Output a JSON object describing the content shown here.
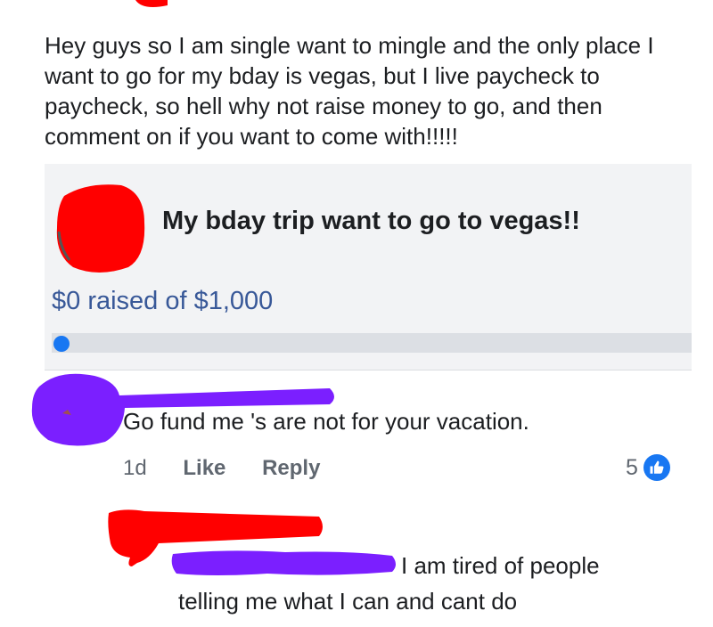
{
  "post": {
    "text": "Hey guys so I am single want to mingle and the only place I want to go for my bday is vegas, but I live paycheck to paycheck, so hell why not raise money to go, and then comment on if you want to come with!!!!!"
  },
  "fundraiser": {
    "title": "My bday trip want to go to vegas!!",
    "raised_label": "$0 raised of $1,000",
    "progress_fraction": 0.0,
    "accent_color": "#385898",
    "bar_color": "#1877f2"
  },
  "comment": {
    "text": "Go fund me 's are not for your vacation.",
    "time": "1d",
    "like_label": "Like",
    "reply_label": "Reply",
    "reaction_count": "5",
    "reaction_icon": "thumbs-up-icon"
  },
  "reply": {
    "line1": "I am tired of people",
    "line2": "telling me what I can and cant do"
  },
  "redaction_colors": {
    "red": "#ff0000",
    "purple": "#7b1fff"
  }
}
